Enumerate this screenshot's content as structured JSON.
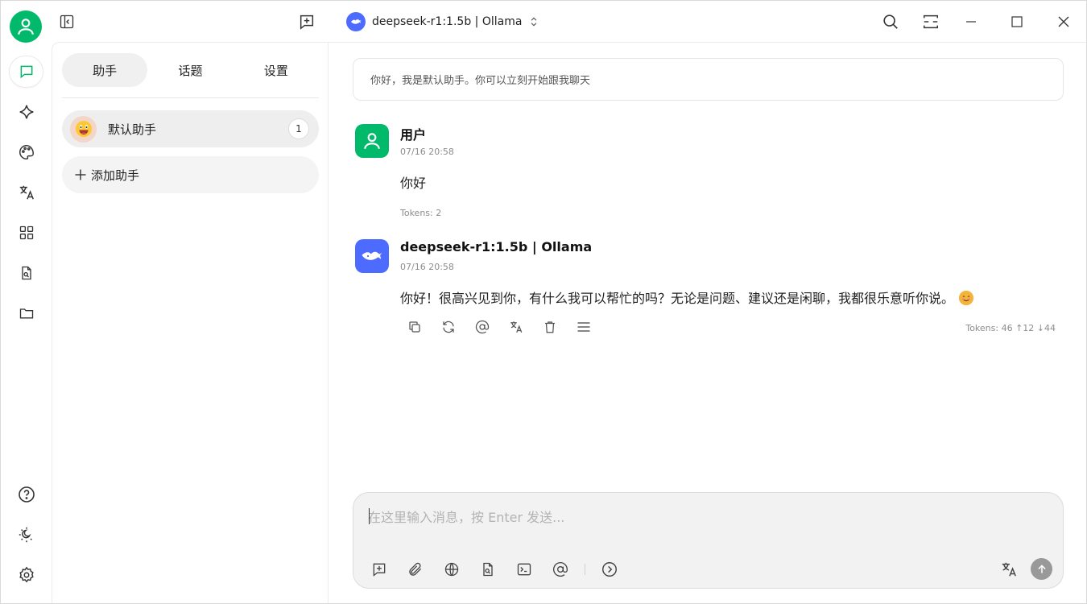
{
  "titlebar": {
    "model_name": "deepseek-r1:1.5b | Ollama"
  },
  "nav_rail": {
    "items": [
      {
        "icon": "chat-icon",
        "active": true
      },
      {
        "icon": "sparkle-icon",
        "active": false
      },
      {
        "icon": "palette-icon",
        "active": false
      },
      {
        "icon": "translate-icon",
        "active": false
      },
      {
        "icon": "apps-grid-icon",
        "active": false
      },
      {
        "icon": "file-search-icon",
        "active": false
      },
      {
        "icon": "folder-icon",
        "active": false
      }
    ],
    "bottom": [
      "help-icon",
      "theme-icon",
      "settings-icon"
    ]
  },
  "sidebar": {
    "tabs": [
      {
        "label": "助手",
        "active": true
      },
      {
        "label": "话题",
        "active": false
      },
      {
        "label": "设置",
        "active": false
      }
    ],
    "assistants": [
      {
        "name": "默认助手",
        "count": "1"
      }
    ],
    "add_label": "添加助手"
  },
  "chat": {
    "system_prompt": "你好，我是默认助手。你可以立刻开始跟我聊天",
    "messages": [
      {
        "role": "user",
        "name": "用户",
        "time": "07/16 20:58",
        "text": "你好",
        "tokens": "Tokens: 2"
      },
      {
        "role": "assistant",
        "name": "deepseek-r1:1.5b | Ollama",
        "time": "07/16 20:58",
        "text": "你好！很高兴见到你，有什么我可以帮忙的吗？无论是问题、建议还是闲聊，我都很乐意听你说。",
        "tokens": "Tokens: 46 ↑12 ↓44",
        "actions": [
          "copy-icon",
          "regenerate-icon",
          "mention-icon",
          "translate-icon",
          "delete-icon",
          "menu-icon"
        ]
      }
    ]
  },
  "input": {
    "placeholder": "在这里输入消息，按 Enter 发送...",
    "value": ""
  },
  "colors": {
    "accent_green": "#00b96b",
    "deepseek_blue": "#4d6bfe",
    "send_disabled": "#999999"
  }
}
